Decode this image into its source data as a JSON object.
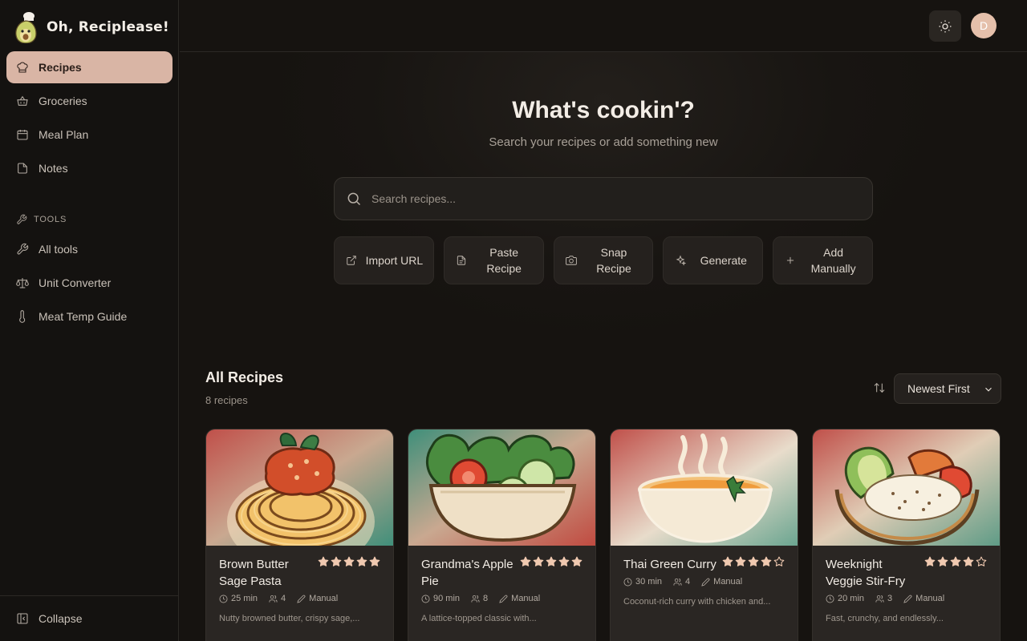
{
  "app": {
    "title": "Oh, Reciplease!",
    "avatar_initial": "D"
  },
  "sidebar": {
    "nav": [
      {
        "label": "Recipes",
        "icon": "chef-hat-icon",
        "active": true
      },
      {
        "label": "Groceries",
        "icon": "basket-icon",
        "active": false
      },
      {
        "label": "Meal Plan",
        "icon": "calendar-icon",
        "active": false
      },
      {
        "label": "Notes",
        "icon": "note-icon",
        "active": false
      }
    ],
    "tools_label": "TOOLS",
    "tools": [
      {
        "label": "All tools",
        "icon": "wrench-icon"
      },
      {
        "label": "Unit Converter",
        "icon": "scale-icon"
      },
      {
        "label": "Meat Temp Guide",
        "icon": "thermometer-icon"
      }
    ],
    "collapse_label": "Collapse"
  },
  "hero": {
    "title": "What's cookin'?",
    "subtitle": "Search your recipes or add something new",
    "search_placeholder": "Search recipes..."
  },
  "actions": [
    {
      "label": "Import URL",
      "icon": "external-link-icon"
    },
    {
      "label": "Paste Recipe",
      "icon": "file-icon"
    },
    {
      "label": "Snap Recipe",
      "icon": "camera-icon"
    },
    {
      "label": "Generate",
      "icon": "sparkles-icon"
    },
    {
      "label": "Add Manually",
      "icon": "plus-icon"
    }
  ],
  "recipes_section": {
    "title": "All Recipes",
    "count": "8 recipes",
    "sort_value": "Newest First",
    "sort_options": [
      "Newest First"
    ]
  },
  "colors": {
    "accent": "#d9b5a5",
    "star": "#f0c9b0",
    "background": "#141210",
    "card": "#2a2623"
  },
  "recipes": [
    {
      "title": "Brown Butter Sage Pasta",
      "rating": 5,
      "time": "25 min",
      "servings": "4",
      "source": "Manual",
      "description": "Nutty browned butter, crispy sage,...",
      "image": "spaghetti"
    },
    {
      "title": "Grandma's Apple Pie",
      "rating": 5,
      "time": "90 min",
      "servings": "8",
      "source": "Manual",
      "description": "A lattice-topped classic with...",
      "image": "salad"
    },
    {
      "title": "Thai Green Curry",
      "rating": 4,
      "time": "30 min",
      "servings": "4",
      "source": "Manual",
      "description": "Coconut-rich curry with chicken and...",
      "image": "soup"
    },
    {
      "title": "Weeknight Veggie Stir-Fry",
      "rating": 4,
      "time": "20 min",
      "servings": "3",
      "source": "Manual",
      "description": "Fast, crunchy, and endlessly...",
      "image": "bowl"
    }
  ]
}
